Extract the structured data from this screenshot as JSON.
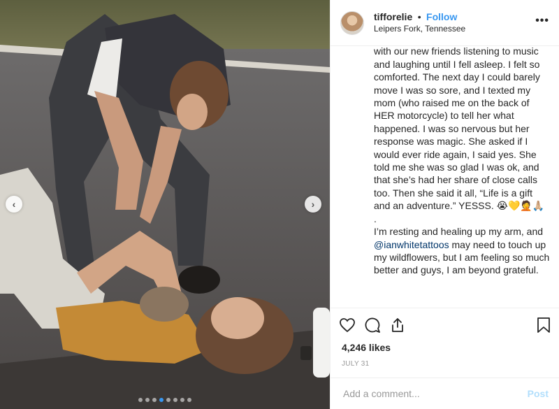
{
  "header": {
    "username": "tifforelie",
    "separator": "•",
    "follow_label": "Follow",
    "location": "Leipers Fork, Tennessee",
    "more": "•••"
  },
  "caption": {
    "text_before_mention": "cleaned me up in the ambulance, sat with our new friends listening to music and laughing until I fell asleep. I felt so comforted. The next day I could barely move I was so sore, and I texted my mom (who raised me on the back of HER motorcycle) to tell her what happened. I was so nervous but her response was magic. She asked if I would ever ride again, I said yes. She told me she was so glad I was ok, and that she’s had her share of close calls too. Then she said it all, “Life is a gift and an adventure.” YESSS. 😭💛🤦🙏🏼\n.\nI’m resting and healing up my arm, and ",
    "mention": "@ianwhitetattoos",
    "text_after_mention": " may need to touch up my wildflowers, but I am feeling so much better and guys, I am beyond grateful."
  },
  "actions": {
    "likes": "4,246 likes",
    "date": "JULY 31",
    "icons": [
      "heart-icon",
      "comment-icon",
      "share-icon",
      "bookmark-icon"
    ]
  },
  "comment_box": {
    "placeholder": "Add a comment...",
    "post_label": "Post"
  },
  "carousel": {
    "prev_glyph": "‹",
    "next_glyph": "›",
    "dot_count": 8,
    "active_dot": 3
  },
  "colors": {
    "accent": "#3897f0",
    "text": "#262626",
    "muted": "#999999",
    "post_disabled": "#b2dffc",
    "mention": "#003569"
  }
}
